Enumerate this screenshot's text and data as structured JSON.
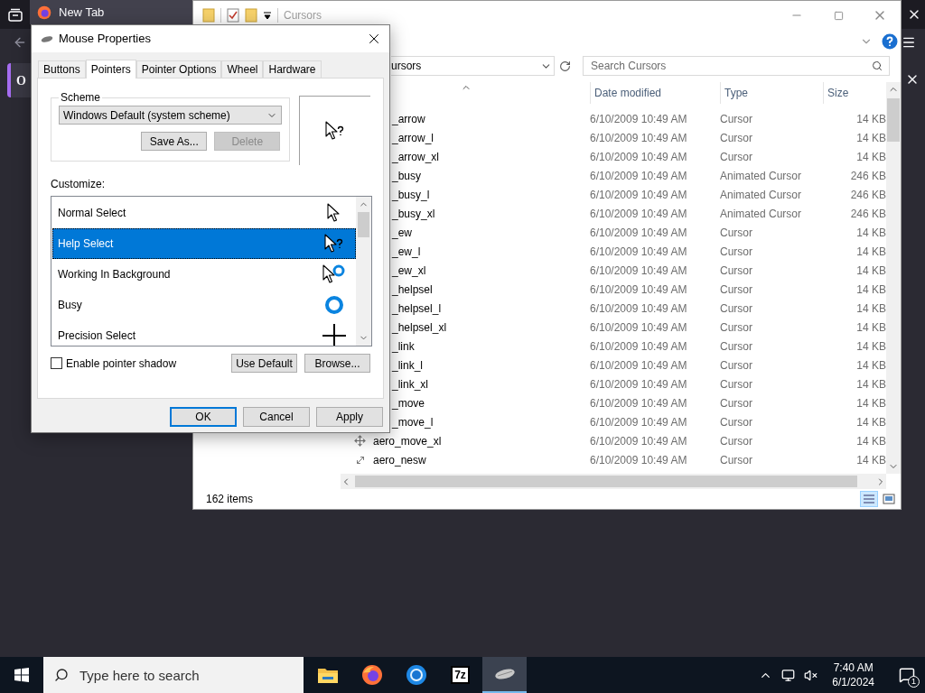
{
  "browser": {
    "tab": "New Tab",
    "button": "O"
  },
  "explorer": {
    "title": "Cursors",
    "address": "ursors",
    "search": {
      "placeholder": "Search Cursors"
    },
    "columns": [
      "Date modified",
      "Type",
      "Size"
    ],
    "rows": [
      {
        "name": "_arrow",
        "date": "6/10/2009 10:49 AM",
        "type": "Cursor",
        "size": "14 KB",
        "kind": "partial"
      },
      {
        "name": "_arrow_l",
        "date": "6/10/2009 10:49 AM",
        "type": "Cursor",
        "size": "14 KB",
        "kind": "partial"
      },
      {
        "name": "_arrow_xl",
        "date": "6/10/2009 10:49 AM",
        "type": "Cursor",
        "size": "14 KB",
        "kind": "partial"
      },
      {
        "name": "_busy",
        "date": "6/10/2009 10:49 AM",
        "type": "Animated Cursor",
        "size": "246 KB",
        "kind": "partial"
      },
      {
        "name": "_busy_l",
        "date": "6/10/2009 10:49 AM",
        "type": "Animated Cursor",
        "size": "246 KB",
        "kind": "partial"
      },
      {
        "name": "_busy_xl",
        "date": "6/10/2009 10:49 AM",
        "type": "Animated Cursor",
        "size": "246 KB",
        "kind": "partial"
      },
      {
        "name": "_ew",
        "date": "6/10/2009 10:49 AM",
        "type": "Cursor",
        "size": "14 KB",
        "kind": "partial"
      },
      {
        "name": "_ew_l",
        "date": "6/10/2009 10:49 AM",
        "type": "Cursor",
        "size": "14 KB",
        "kind": "partial"
      },
      {
        "name": "_ew_xl",
        "date": "6/10/2009 10:49 AM",
        "type": "Cursor",
        "size": "14 KB",
        "kind": "partial"
      },
      {
        "name": "_helpsel",
        "date": "6/10/2009 10:49 AM",
        "type": "Cursor",
        "size": "14 KB",
        "kind": "partial"
      },
      {
        "name": "_helpsel_l",
        "date": "6/10/2009 10:49 AM",
        "type": "Cursor",
        "size": "14 KB",
        "kind": "partial"
      },
      {
        "name": "_helpsel_xl",
        "date": "6/10/2009 10:49 AM",
        "type": "Cursor",
        "size": "14 KB",
        "kind": "partial"
      },
      {
        "name": "_link",
        "date": "6/10/2009 10:49 AM",
        "type": "Cursor",
        "size": "14 KB",
        "kind": "partial"
      },
      {
        "name": "_link_l",
        "date": "6/10/2009 10:49 AM",
        "type": "Cursor",
        "size": "14 KB",
        "kind": "partial"
      },
      {
        "name": "_link_xl",
        "date": "6/10/2009 10:49 AM",
        "type": "Cursor",
        "size": "14 KB",
        "kind": "partial"
      },
      {
        "name": "_move",
        "date": "6/10/2009 10:49 AM",
        "type": "Cursor",
        "size": "14 KB",
        "kind": "partial"
      },
      {
        "name": "_move_l",
        "date": "6/10/2009 10:49 AM",
        "type": "Cursor",
        "size": "14 KB",
        "kind": "partial"
      },
      {
        "name": "aero_move_xl",
        "date": "6/10/2009 10:49 AM",
        "type": "Cursor",
        "size": "14 KB",
        "kind": "move"
      },
      {
        "name": "aero_nesw",
        "date": "6/10/2009 10:49 AM",
        "type": "Cursor",
        "size": "14 KB",
        "kind": "resize"
      }
    ],
    "status": "162 items"
  },
  "dialog": {
    "title": "Mouse Properties",
    "tabs": [
      {
        "label": "Buttons",
        "selected": false
      },
      {
        "label": "Pointers",
        "selected": true
      },
      {
        "label": "Pointer Options",
        "selected": false
      },
      {
        "label": "Wheel",
        "selected": false
      },
      {
        "label": "Hardware",
        "selected": false
      }
    ],
    "scheme": {
      "label": "Scheme",
      "value": "Windows Default (system scheme)",
      "buttons": [
        {
          "label": "Save As...",
          "disabled": false
        },
        {
          "label": "Delete",
          "disabled": true
        }
      ]
    },
    "customize_label": "Customize:",
    "cursors": [
      {
        "name": "Normal Select",
        "kind": "arrow",
        "selected": false
      },
      {
        "name": "Help Select",
        "kind": "help",
        "selected": true
      },
      {
        "name": "Working In Background",
        "kind": "working",
        "selected": false
      },
      {
        "name": "Busy",
        "kind": "busy",
        "selected": false
      },
      {
        "name": "Precision Select",
        "kind": "cross",
        "selected": false
      }
    ],
    "shadow": {
      "label": "Enable pointer shadow",
      "checked": false
    },
    "list_buttons": [
      "Use Default",
      "Browse..."
    ],
    "buttons": [
      {
        "label": "OK",
        "default": true
      },
      {
        "label": "Cancel",
        "default": false
      },
      {
        "label": "Apply",
        "default": false
      }
    ]
  },
  "taskbar": {
    "search_placeholder": "Type here to search",
    "apps": [
      {
        "kind": "explorer",
        "active": false
      },
      {
        "kind": "firefox",
        "active": false
      },
      {
        "kind": "browser",
        "active": false
      },
      {
        "kind": "archiver",
        "label": "7z",
        "active": false
      },
      {
        "kind": "mouse",
        "active": true
      }
    ],
    "time": "7:40 AM",
    "date": "6/1/2024",
    "notifications": "1"
  }
}
